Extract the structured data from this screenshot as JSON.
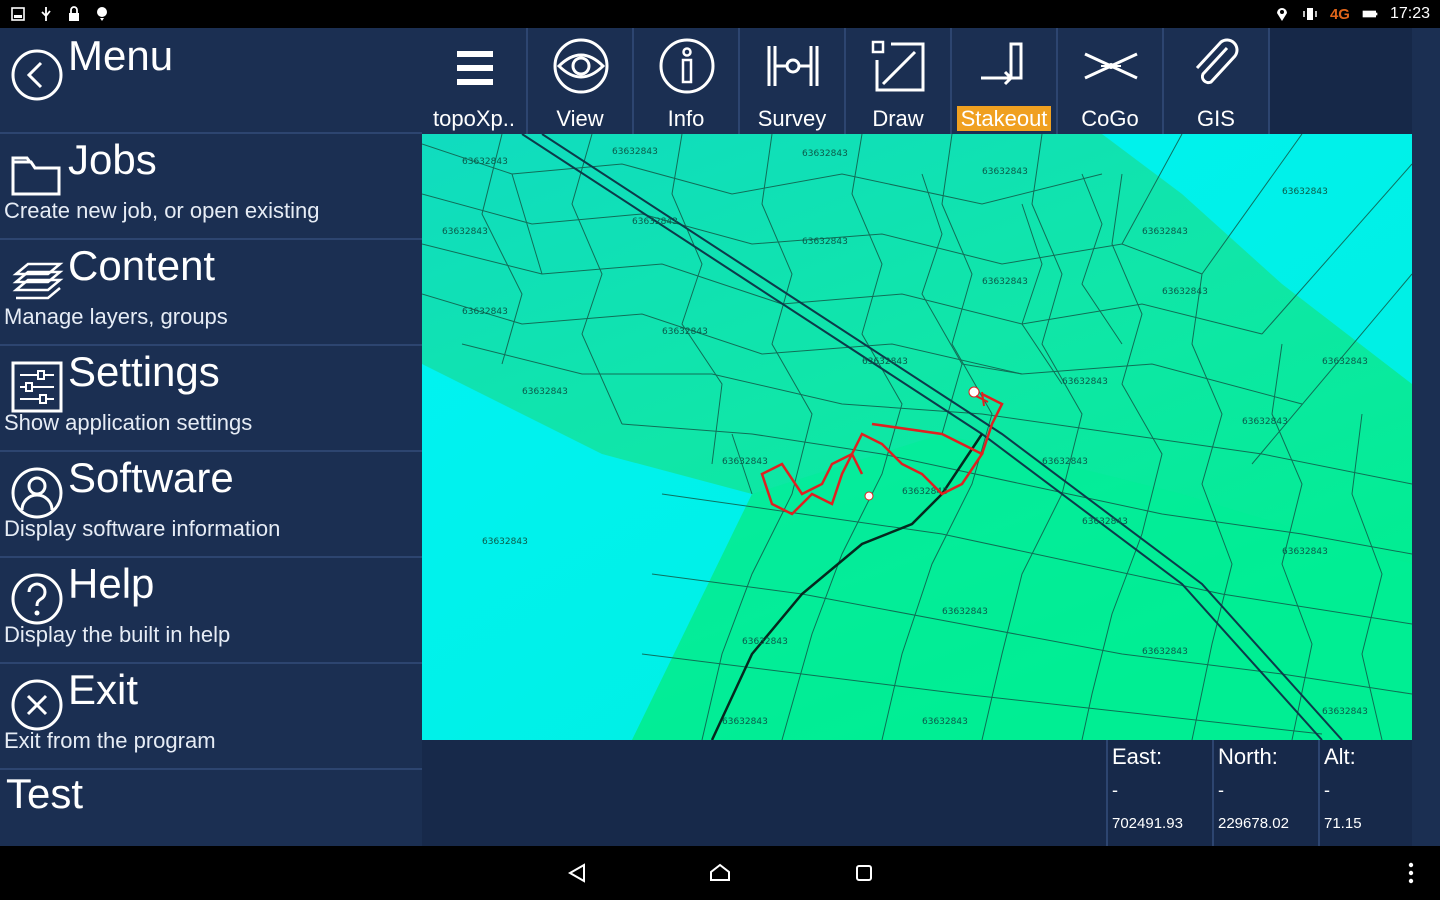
{
  "status_bar": {
    "network": "4G",
    "time": "17:23",
    "left_icons": [
      "screenshot-icon",
      "usb-icon",
      "lock-icon",
      "location-pin-icon"
    ],
    "right_icons": [
      "location-icon",
      "vibrate-icon",
      "battery-icon"
    ]
  },
  "menu": {
    "title": "Menu",
    "items": [
      {
        "title": "Jobs",
        "subtitle": "Create new job, or open existing",
        "icon": "folder-icon"
      },
      {
        "title": "Content",
        "subtitle": "Manage layers, groups",
        "icon": "layers-icon"
      },
      {
        "title": "Settings",
        "subtitle": "Show application settings",
        "icon": "settings-sliders-icon"
      },
      {
        "title": "Software",
        "subtitle": "Display software information",
        "icon": "user-icon"
      },
      {
        "title": "Help",
        "subtitle": "Display the built in help",
        "icon": "help-icon"
      },
      {
        "title": "Exit",
        "subtitle": "Exit from the program",
        "icon": "close-icon"
      }
    ],
    "test_label": "Test"
  },
  "toolbar": {
    "tools": [
      {
        "label": "topoXp..",
        "icon": "hamburger-icon"
      },
      {
        "label": "View",
        "icon": "eye-icon"
      },
      {
        "label": "Info",
        "icon": "info-icon"
      },
      {
        "label": "Survey",
        "icon": "survey-icon"
      },
      {
        "label": "Draw",
        "icon": "draw-icon"
      },
      {
        "label": "Stakeout",
        "icon": "stakeout-icon",
        "active": true
      },
      {
        "label": "CoGo",
        "icon": "cogo-icon"
      },
      {
        "label": "GIS",
        "icon": "paperclip-icon"
      }
    ],
    "active_color": "#f0a020"
  },
  "coordinates": {
    "east": {
      "label": "East:",
      "dash": "-",
      "value": "702491.93"
    },
    "north": {
      "label": "North:",
      "dash": "-",
      "value": "229678.02"
    },
    "alt": {
      "label": "Alt:",
      "dash": "-",
      "value": "71.15"
    }
  },
  "colors": {
    "panel": "#1b2f52",
    "map_cyan": "#00f2f2",
    "map_green": "#00ea9a",
    "track": "#e02020"
  }
}
